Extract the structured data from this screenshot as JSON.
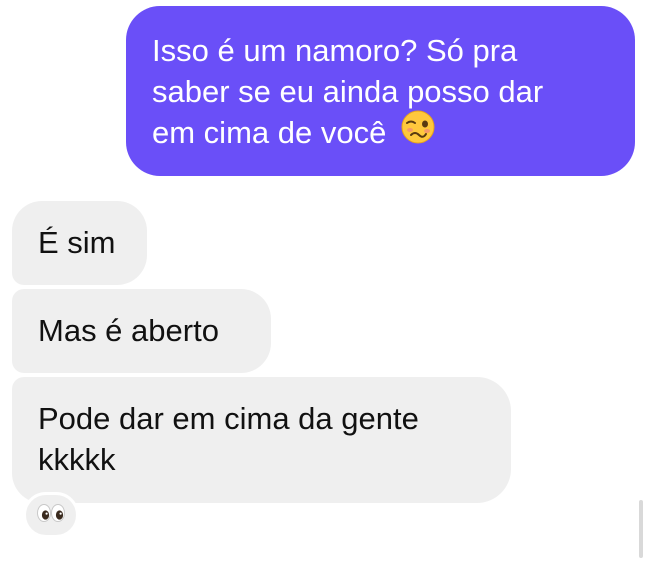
{
  "conversation": {
    "sent": {
      "lines": [
        "Isso é um namoro? Só pra",
        "saber se eu ainda posso dar",
        "em cima de você"
      ],
      "emoji": "woozy-face"
    },
    "received": [
      {
        "lines": [
          "É sim"
        ]
      },
      {
        "lines": [
          "Mas é aberto"
        ]
      },
      {
        "lines": [
          "Pode dar em cima da gente",
          "kkkkk"
        ]
      }
    ],
    "reaction": "eyes"
  },
  "colors": {
    "sent_bubble": "#6a4ff8",
    "received_bubble": "#efefef",
    "sent_text": "#ffffff",
    "received_text": "#111111"
  }
}
